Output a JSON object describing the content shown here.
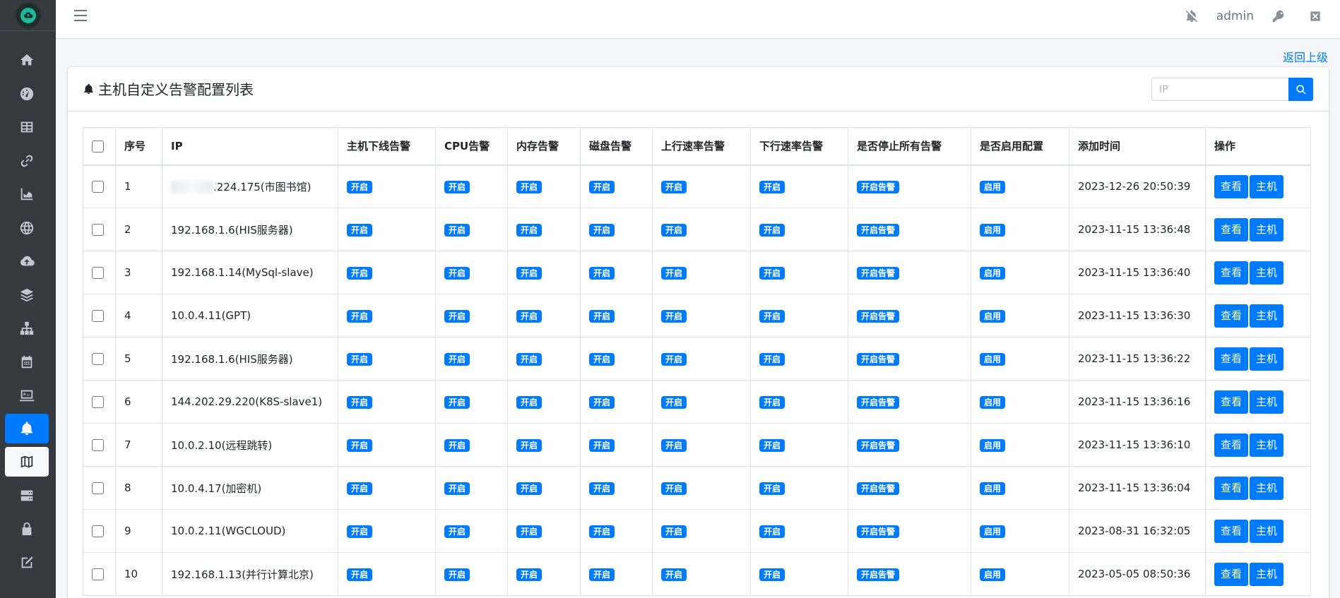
{
  "header": {
    "user": "admin"
  },
  "back_link": "返回上级",
  "card": {
    "title": "主机自定义告警配置列表",
    "search_placeholder": "IP"
  },
  "table": {
    "columns": [
      "序号",
      "IP",
      "主机下线告警",
      "CPU告警",
      "内存告警",
      "磁盘告警",
      "上行速率告警",
      "下行速率告警",
      "是否停止所有告警",
      "是否启用配置",
      "添加时间",
      "操作"
    ],
    "badge_on": "开启",
    "badge_all": "开启告警",
    "badge_enabled": "启用",
    "btn_view": "查看",
    "btn_host": "主机",
    "rows": [
      {
        "no": "1",
        "ip": ".224.175(市图书馆)",
        "time": "2023-12-26 20:50:39"
      },
      {
        "no": "2",
        "ip": "192.168.1.6(HIS服务器)",
        "time": "2023-11-15 13:36:48"
      },
      {
        "no": "3",
        "ip": "192.168.1.14(MySql-slave)",
        "time": "2023-11-15 13:36:40"
      },
      {
        "no": "4",
        "ip": "10.0.4.11(GPT)",
        "time": "2023-11-15 13:36:30"
      },
      {
        "no": "5",
        "ip": "192.168.1.6(HIS服务器)",
        "time": "2023-11-15 13:36:22"
      },
      {
        "no": "6",
        "ip": "144.202.29.220(K8S-slave1)",
        "time": "2023-11-15 13:36:16"
      },
      {
        "no": "7",
        "ip": "10.0.2.10(远程跳转)",
        "time": "2023-11-15 13:36:10"
      },
      {
        "no": "8",
        "ip": "10.0.4.17(加密机)",
        "time": "2023-11-15 13:36:04"
      },
      {
        "no": "9",
        "ip": "10.0.2.11(WGCLOUD)",
        "time": "2023-08-31 16:32:05"
      },
      {
        "no": "10",
        "ip": "192.168.1.13(并行计算北京)",
        "time": "2023-05-05 08:50:36"
      }
    ]
  },
  "icons": {
    "sidebar": [
      "home-icon",
      "dashboard-icon",
      "table-icon",
      "link-icon",
      "chart-area-icon",
      "globe-icon",
      "cloud-upload-icon",
      "layers-icon",
      "network-icon",
      "calendar-icon",
      "terminal-icon",
      "bell-icon",
      "map-icon",
      "server-icon",
      "lock-icon",
      "edit-icon"
    ],
    "top": [
      "bell-slash-icon",
      "key-icon",
      "close-window-icon"
    ]
  },
  "colors": {
    "accent": "#007bff",
    "sidebar": "#343a40"
  }
}
